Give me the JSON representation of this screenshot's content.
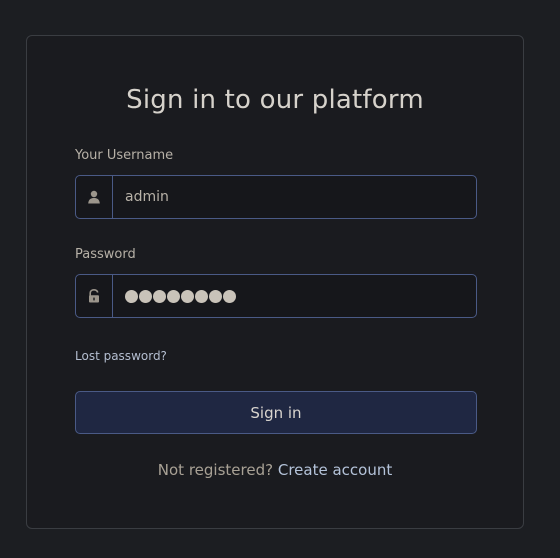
{
  "form": {
    "title": "Sign in to our platform",
    "username": {
      "label": "Your Username",
      "value": "admin",
      "icon": "user-icon"
    },
    "password": {
      "label": "Password",
      "masked_length": 8,
      "icon": "unlock-icon"
    },
    "lost_password": "Lost password?",
    "submit_label": "Sign in",
    "register_prompt": "Not registered?",
    "register_link": "Create account"
  },
  "colors": {
    "background": "#1c1e22",
    "card": "#1a1b1f",
    "input_border": "#4a5a86",
    "button_bg": "#1f2742"
  }
}
